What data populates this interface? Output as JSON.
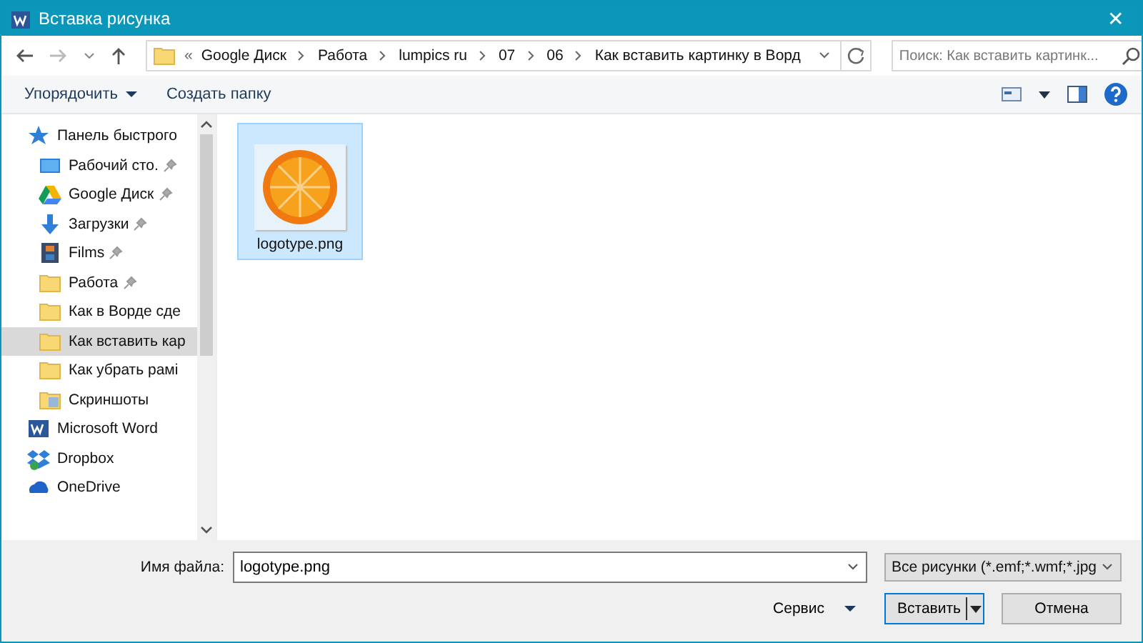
{
  "window": {
    "title": "Вставка рисунка",
    "close": "✕"
  },
  "address": {
    "overflow": "«",
    "path": [
      "Google Диск",
      "Работа",
      "lumpics ru",
      "07",
      "06",
      "Как вставить картинку в Ворд"
    ]
  },
  "search": {
    "placeholder": "Поиск: Как вставить картинк..."
  },
  "toolbar": {
    "organize": "Упорядочить",
    "new_folder": "Создать папку"
  },
  "sidebar": {
    "items": [
      {
        "label": "Панель быстрого",
        "kind": "star",
        "selected": false,
        "children": [
          {
            "label": "Рабочий сто.",
            "kind": "desktop",
            "pinned": true,
            "selected": false
          },
          {
            "label": "Google Диск",
            "kind": "drive",
            "pinned": true,
            "selected": false
          },
          {
            "label": "Загрузки",
            "kind": "download",
            "pinned": true,
            "selected": false
          },
          {
            "label": "Films",
            "kind": "film",
            "pinned": true,
            "selected": false
          },
          {
            "label": "Работа",
            "kind": "folder",
            "pinned": true,
            "selected": false
          },
          {
            "label": "Как в Ворде сде",
            "kind": "folder",
            "pinned": false,
            "selected": false
          },
          {
            "label": "Как вставить кар",
            "kind": "folder",
            "pinned": false,
            "selected": true
          },
          {
            "label": "Как убрать рамі",
            "kind": "folder",
            "pinned": false,
            "selected": false
          },
          {
            "label": "Скриншоты",
            "kind": "pictures",
            "pinned": false,
            "selected": false
          }
        ]
      },
      {
        "label": "Microsoft Word",
        "kind": "word",
        "selected": false
      },
      {
        "label": "Dropbox",
        "kind": "dropbox",
        "selected": false
      },
      {
        "label": "OneDrive",
        "kind": "cloud",
        "selected": false
      }
    ]
  },
  "files": [
    {
      "name": "logotype.png",
      "selected": true
    }
  ],
  "footer": {
    "filename_label": "Имя файла:",
    "filename": "logotype.png",
    "filter": "Все рисунки (*.emf;*.wmf;*.jpg",
    "tools": "Сервис",
    "insert": "Вставить",
    "cancel": "Отмена"
  }
}
